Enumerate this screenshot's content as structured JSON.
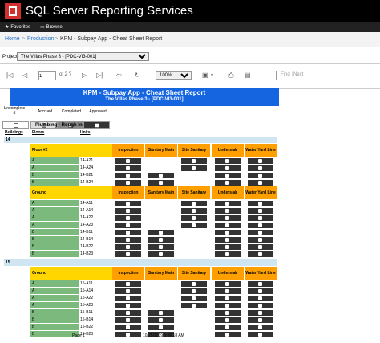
{
  "app": {
    "title": "SQL Server Reporting Services"
  },
  "toolbar": {
    "favorites": "Favorites",
    "browse": "Browse"
  },
  "breadcrumb": {
    "home": "Home",
    "production": "Production",
    "report": "KPM - Subpay App - Cheat Sheet Report"
  },
  "params": {
    "label": "Project",
    "value": "The Villas Phase 3 - [PDC-VI3-001]"
  },
  "viewer": {
    "page": "1",
    "of": "of 2 ?",
    "zoom": "100%",
    "find": "Find",
    "next": "Next"
  },
  "report": {
    "title": "KPM - Subpay App - Cheat Sheet Report",
    "subtitle": "The Villas Phase 3 - [PDC-VI3-001]",
    "legend": [
      "Uncomplete d",
      "Accrued",
      "Completed",
      "Approved"
    ],
    "plumbing": "Plumbing - Rough In",
    "headers": [
      "Buildings",
      "Floors",
      "Units"
    ],
    "columns": [
      "Inspection",
      "Sanitary Main",
      "Site Sanitary",
      "Underslab",
      "Water Yard Line"
    ],
    "buildings": [
      {
        "name": "14",
        "floors": [
          {
            "name": "Floor #2",
            "rows": [
              {
                "a": "A",
                "u": "14-A21",
                "m": [
                  1,
                  0,
                  1,
                  1,
                  1
                ]
              },
              {
                "a": "A",
                "u": "14-A24",
                "m": [
                  1,
                  0,
                  1,
                  1,
                  1
                ]
              },
              {
                "a": "B",
                "u": "14-B21",
                "m": [
                  1,
                  1,
                  0,
                  1,
                  1
                ]
              },
              {
                "a": "B",
                "u": "14-B24",
                "m": [
                  1,
                  1,
                  0,
                  1,
                  1
                ]
              }
            ]
          },
          {
            "name": "Ground",
            "rows": [
              {
                "a": "A",
                "u": "14-A11",
                "m": [
                  1,
                  0,
                  1,
                  1,
                  1
                ]
              },
              {
                "a": "A",
                "u": "14-A14",
                "m": [
                  1,
                  0,
                  1,
                  1,
                  1
                ]
              },
              {
                "a": "A",
                "u": "14-A22",
                "m": [
                  1,
                  0,
                  1,
                  1,
                  1
                ]
              },
              {
                "a": "A",
                "u": "14-A23",
                "m": [
                  1,
                  0,
                  1,
                  1,
                  1
                ]
              },
              {
                "a": "B",
                "u": "14-B11",
                "m": [
                  1,
                  1,
                  0,
                  1,
                  1
                ]
              },
              {
                "a": "B",
                "u": "14-B14",
                "m": [
                  1,
                  1,
                  0,
                  1,
                  1
                ]
              },
              {
                "a": "B",
                "u": "14-B22",
                "m": [
                  1,
                  1,
                  0,
                  1,
                  1
                ]
              },
              {
                "a": "B",
                "u": "14-B23",
                "m": [
                  1,
                  1,
                  0,
                  1,
                  1
                ]
              }
            ]
          }
        ]
      },
      {
        "name": "15",
        "floors": [
          {
            "name": "Ground",
            "rows": [
              {
                "a": "A",
                "u": "15-A11",
                "m": [
                  1,
                  0,
                  1,
                  1,
                  1
                ]
              },
              {
                "a": "A",
                "u": "15-A14",
                "m": [
                  1,
                  0,
                  1,
                  1,
                  1
                ]
              },
              {
                "a": "A",
                "u": "15-A22",
                "m": [
                  1,
                  0,
                  1,
                  1,
                  1
                ]
              },
              {
                "a": "A",
                "u": "15-A23",
                "m": [
                  1,
                  0,
                  1,
                  1,
                  1
                ]
              },
              {
                "a": "B",
                "u": "15-B11",
                "m": [
                  1,
                  1,
                  0,
                  1,
                  1
                ]
              },
              {
                "a": "B",
                "u": "15-B14",
                "m": [
                  1,
                  1,
                  0,
                  1,
                  1
                ]
              },
              {
                "a": "B",
                "u": "15-B22",
                "m": [
                  1,
                  1,
                  0,
                  1,
                  1
                ]
              },
              {
                "a": "B",
                "u": "15-B23",
                "m": [
                  1,
                  1,
                  0,
                  1,
                  1
                ]
              }
            ]
          }
        ]
      }
    ],
    "footer": {
      "page": "Page 1",
      "timestamp": "10/25/2019 5:06:18 AM"
    }
  }
}
